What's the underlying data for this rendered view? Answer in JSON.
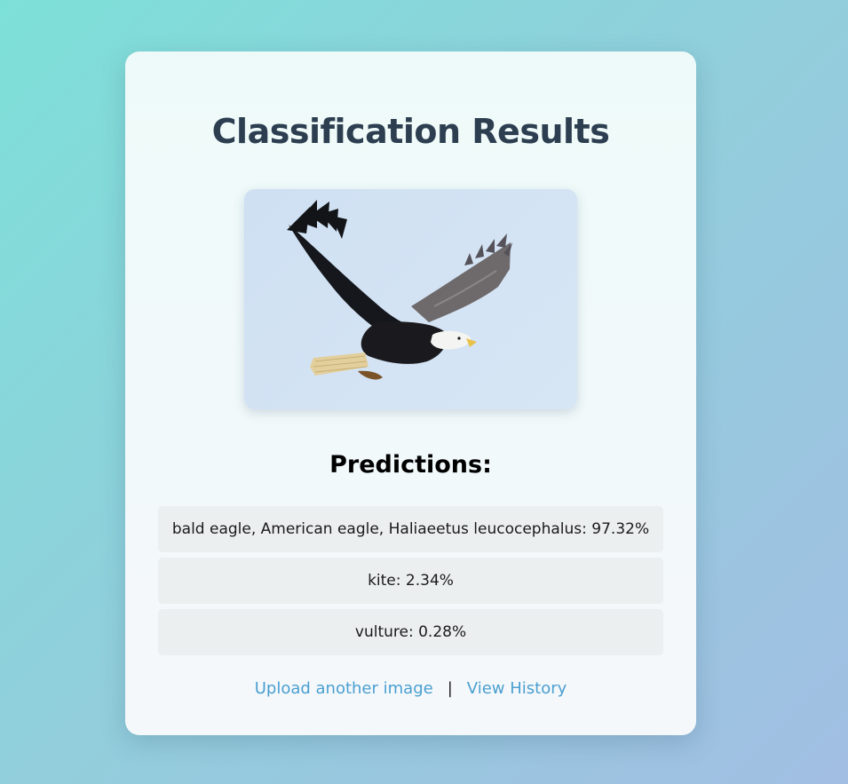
{
  "page": {
    "title": "Classification Results",
    "predictions_heading": "Predictions:"
  },
  "image": {
    "subject": "bald-eagle-in-flight"
  },
  "predictions": [
    {
      "text": "bald eagle, American eagle, Haliaeetus leucocephalus: 97.32%"
    },
    {
      "text": "kite: 2.34%"
    },
    {
      "text": "vulture: 0.28%"
    }
  ],
  "links": {
    "upload_label": "Upload another image",
    "separator": "|",
    "history_label": "View History"
  },
  "colors": {
    "title": "#2c3e50",
    "link": "#4a9fd0",
    "card_background": "#f3f8fa",
    "prediction_background": "#eceff0"
  }
}
